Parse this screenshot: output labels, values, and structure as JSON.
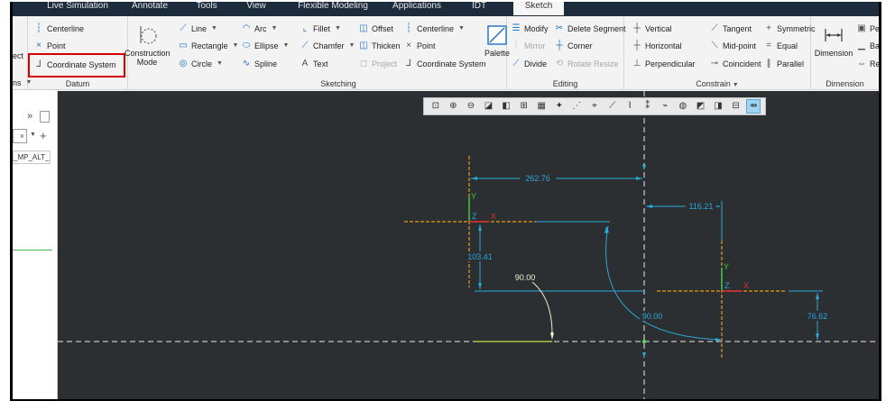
{
  "tabs": [
    {
      "label": "Live Simulation",
      "active": false
    },
    {
      "label": "Annotate",
      "active": false
    },
    {
      "label": "Tools",
      "active": false
    },
    {
      "label": "View",
      "active": false
    },
    {
      "label": "Flexible Modeling",
      "active": false
    },
    {
      "label": "Applications",
      "active": false
    },
    {
      "label": "IDT",
      "active": false
    },
    {
      "label": "Sketch",
      "active": true
    }
  ],
  "ribbon": {
    "datum": {
      "label": "Datum",
      "partial_left": "ect",
      "partial_left_bottom": "ns",
      "centerline": "Centerline",
      "point": "Point",
      "coordinate_system": "Coordinate System",
      "construction_mode": "Construction Mode"
    },
    "sketching": {
      "label": "Sketching",
      "line": "Line",
      "arc": "Arc",
      "fillet": "Fillet",
      "offset": "Offset",
      "centerline": "Centerline",
      "rectangle": "Rectangle",
      "ellipse": "Ellipse",
      "chamfer": "Chamfer",
      "thicken": "Thicken",
      "point": "Point",
      "circle": "Circle",
      "spline": "Spline",
      "text": "Text",
      "project": "Project",
      "coordinate_system": "Coordinate System",
      "palette": "Palette"
    },
    "editing": {
      "label": "Editing",
      "modify": "Modify",
      "delete_segment": "Delete Segment",
      "mirror": "Mirror",
      "corner": "Corner",
      "divide": "Divide",
      "rotate_resize": "Rotate Resize"
    },
    "constrain": {
      "label": "Constrain",
      "vertical": "Vertical",
      "tangent": "Tangent",
      "symmetric": "Symmetric",
      "horizontal": "Horizontal",
      "mid_point": "Mid-point",
      "equal": "Equal",
      "perpendicular": "Perpendicular",
      "coincident": "Coincident",
      "parallel": "Parallel"
    },
    "dimension": {
      "label": "Dimension",
      "dimension": "Dimension",
      "partial_pe": "Pe",
      "partial_ba": "Ba",
      "partial_re": "Re"
    }
  },
  "left_panel": {
    "partial_item": "_MP_ALT_"
  },
  "view_toolbar": {
    "icons": [
      "refit-icon",
      "zoom-in-icon",
      "zoom-out-icon",
      "repaint-icon",
      "saved-orientations-icon",
      "named-views-icon",
      "display-style-icon",
      "spin-center-icon",
      "annotation-display-icon",
      "datum-display-icon",
      "sketch-dims-icon",
      "sketch-constraints-icon",
      "sketch-grid-icon",
      "sketch-vertices-icon",
      "analysis-icon",
      "layers-icon",
      "perspective-icon",
      "section-icon",
      "sketch-view-icon"
    ]
  },
  "sketch": {
    "dimensions": {
      "d1": "262.76",
      "d2": "116.21",
      "d3": "103.41",
      "d4": "90.00",
      "d5": "90.00",
      "d6": "76.62"
    },
    "axis_labels": {
      "y": "Y",
      "z": "Z",
      "x": "X"
    }
  },
  "colors": {
    "canvas_bg": "#2b2f32",
    "dimension": "#2ba8d8",
    "centerline": "#e8e8e8",
    "csys": "#e59a18",
    "highlight": "#d60000"
  }
}
